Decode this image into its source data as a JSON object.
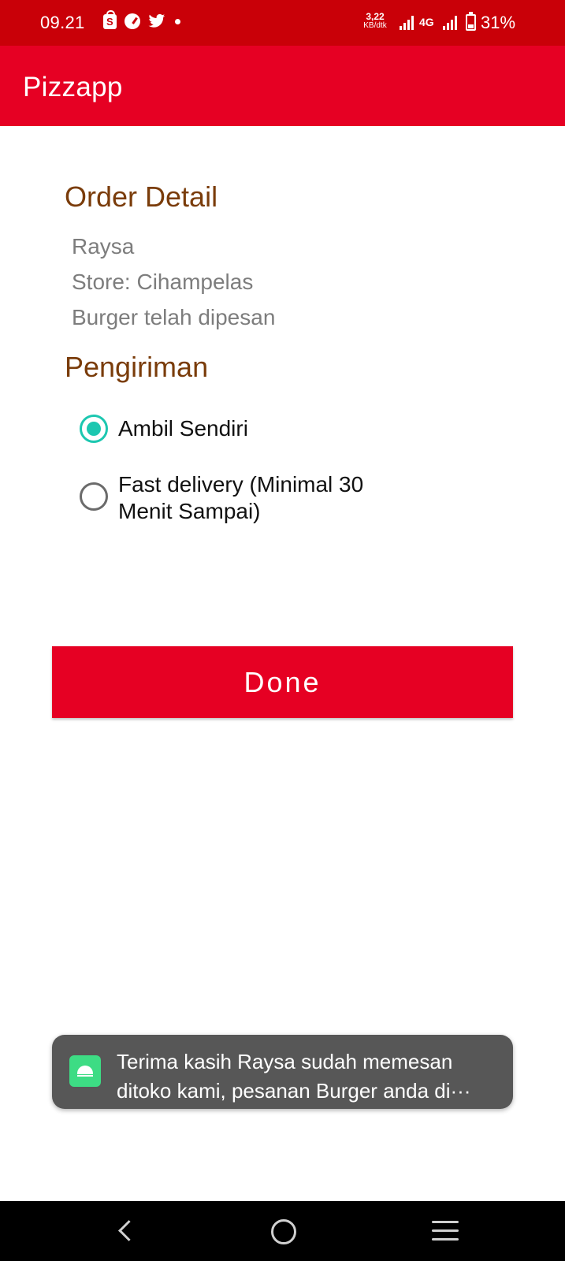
{
  "status_bar": {
    "time": "09.21",
    "net_speed_value": "3,22",
    "net_speed_unit": "KB/dtk",
    "network_type": "4G",
    "battery": "31%",
    "icons": [
      "shopee-icon",
      "speed-gauge-icon",
      "twitter-icon",
      "notification-dot-icon",
      "signal-icon",
      "battery-icon"
    ]
  },
  "app_bar": {
    "title": "Pizzapp",
    "color": "#e60023"
  },
  "order_detail": {
    "heading": "Order Detail",
    "name": "Raysa",
    "store": "Store: Cihampelas",
    "status": "Burger telah dipesan"
  },
  "delivery": {
    "heading": "Pengiriman",
    "options": [
      {
        "label": "Ambil Sendiri",
        "selected": true
      },
      {
        "label_line1": "Fast delivery (Minimal 30",
        "label_line2": "Menit Sampai)",
        "selected": false
      }
    ],
    "accent_color": "#1cc7b0"
  },
  "done_button": {
    "label": "Done"
  },
  "toast": {
    "line1": "Terima kasih Raysa sudah memesan",
    "line2": "ditoko kami, pesanan Burger anda di···"
  },
  "nav_bar": {
    "icons": [
      "back-icon",
      "home-icon",
      "recents-icon"
    ]
  }
}
